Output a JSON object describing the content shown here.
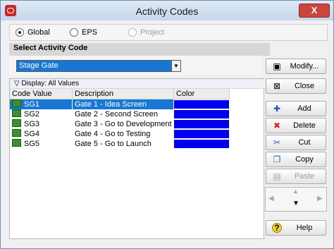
{
  "window": {
    "title": "Activity Codes",
    "close_symbol": "X"
  },
  "scope": {
    "options": [
      {
        "label": "Global",
        "selected": true,
        "enabled": true
      },
      {
        "label": "EPS",
        "selected": false,
        "enabled": true
      },
      {
        "label": "Project",
        "selected": false,
        "enabled": false
      }
    ]
  },
  "select": {
    "heading": "Select Activity Code",
    "value": "Stage Gate"
  },
  "list": {
    "display_label": "Display: All Values",
    "columns": [
      "Code Value",
      "Description",
      "Color"
    ],
    "rows": [
      {
        "code": "SG1",
        "description": "Gate 1 - Idea Screen",
        "color": "#0000ee",
        "selected": true
      },
      {
        "code": "SG2",
        "description": "Gate 2 - Second Screen",
        "color": "#0000ee",
        "selected": false
      },
      {
        "code": "SG3",
        "description": "Gate 3 - Go to Development",
        "color": "#0000ee",
        "selected": false
      },
      {
        "code": "SG4",
        "description": "Gate 4 - Go to Testing",
        "color": "#0000ee",
        "selected": false
      },
      {
        "code": "SG5",
        "description": "Gate 5 - Go to Launch",
        "color": "#0000ee",
        "selected": false
      }
    ]
  },
  "buttons": {
    "modify": "Modify...",
    "close": "Close",
    "add": "Add",
    "delete": "Delete",
    "cut": "Cut",
    "copy": "Copy",
    "paste": "Paste",
    "help": "Help"
  },
  "icons": {
    "modify": "window-edit-icon",
    "close": "close-window-icon",
    "add": "plus-icon",
    "delete": "red-x-icon",
    "cut": "scissors-icon",
    "copy": "copy-icon",
    "paste": "paste-icon",
    "help": "question-icon"
  },
  "colors": {
    "selection": "#1677d4",
    "swatch": "#0000ee",
    "accent_close": "#c9463d"
  }
}
